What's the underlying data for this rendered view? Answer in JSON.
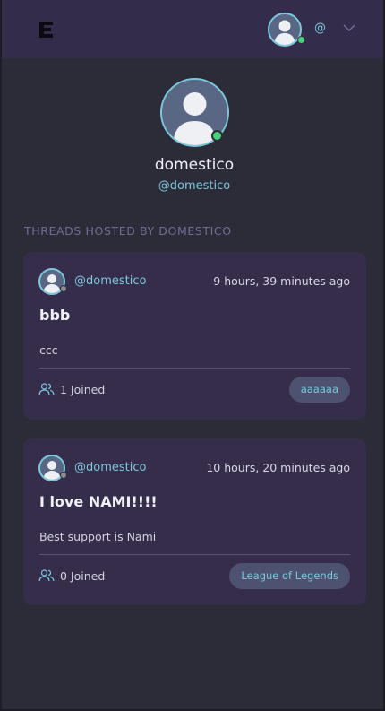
{
  "header": {
    "handle_label": "@",
    "icons": {
      "logo": "app-logo-icon",
      "menu": "chevron-down-icon",
      "avatar": "default-user-avatar"
    }
  },
  "profile": {
    "name": "domestico",
    "handle": "@domestico",
    "online": true
  },
  "section_title": "THREADS HOSTED BY DOMESTICO",
  "threads": [
    {
      "author": "@domestico",
      "time": "9 hours, 39 minutes ago",
      "title": "bbb",
      "body": "ccc",
      "joined": "1 Joined",
      "tag": "aaaaaa"
    },
    {
      "author": "@domestico",
      "time": "10 hours, 20 minutes ago",
      "title": "I love NAMI!!!!",
      "body": "Best support is Nami",
      "joined": "0 Joined",
      "tag": "League of Legends"
    }
  ],
  "colors": {
    "background": "#2c2b38",
    "header": "#342c4b",
    "card": "#362d4b",
    "accent": "#7bc7dc",
    "online": "#46d17c",
    "tag_bg": "#4c5270"
  }
}
